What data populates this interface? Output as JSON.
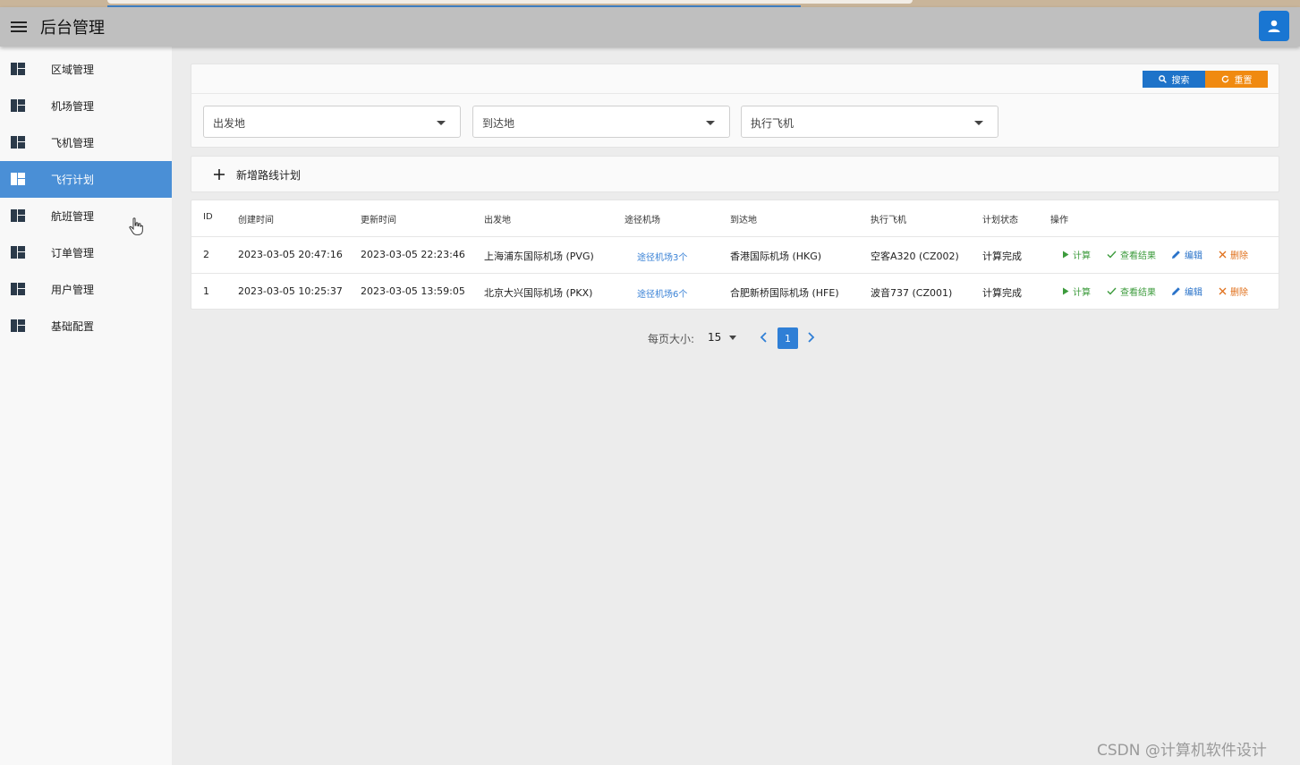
{
  "app": {
    "title": "后台管理"
  },
  "sidebar": {
    "items": [
      {
        "label": "区域管理",
        "active": false
      },
      {
        "label": "机场管理",
        "active": false
      },
      {
        "label": "飞机管理",
        "active": false
      },
      {
        "label": "飞行计划",
        "active": true
      },
      {
        "label": "航班管理",
        "active": false
      },
      {
        "label": "订单管理",
        "active": false
      },
      {
        "label": "用户管理",
        "active": false
      },
      {
        "label": "基础配置",
        "active": false
      }
    ]
  },
  "search": {
    "search_label": "搜索",
    "reset_label": "重置",
    "filters": {
      "departure": "出发地",
      "arrival": "到达地",
      "aircraft": "执行飞机"
    }
  },
  "toolbar": {
    "add_label": "新增路线计划"
  },
  "table": {
    "headers": [
      "ID",
      "创建时间",
      "更新时间",
      "出发地",
      "途径机场",
      "到达地",
      "执行飞机",
      "计划状态",
      "操作"
    ],
    "rows": [
      {
        "id": "2",
        "created": "2023-03-05 20:47:16",
        "updated": "2023-03-05 22:23:46",
        "departure": "上海浦东国际机场 (PVG)",
        "via": "途径机场3个",
        "arrival": "香港国际机场 (HKG)",
        "aircraft": "空客A320 (CZ002)",
        "status": "计算完成"
      },
      {
        "id": "1",
        "created": "2023-03-05 10:25:37",
        "updated": "2023-03-05 13:59:05",
        "departure": "北京大兴国际机场 (PKX)",
        "via": "途径机场6个",
        "arrival": "合肥新桥国际机场 (HFE)",
        "aircraft": "波音737 (CZ001)",
        "status": "计算完成"
      }
    ],
    "actions": {
      "calc": "计算",
      "view": "查看结果",
      "edit": "编辑",
      "delete": "删除"
    }
  },
  "pagination": {
    "page_size_label": "每页大小:",
    "page_size": "15",
    "current_page": "1"
  },
  "watermark": "CSDN @计算机软件设计",
  "colors": {
    "primary": "#1e73c9",
    "warning": "#f08a10",
    "sidebar_active": "#4a8fd6",
    "success": "#3c9b3c",
    "danger": "#e0701b"
  }
}
